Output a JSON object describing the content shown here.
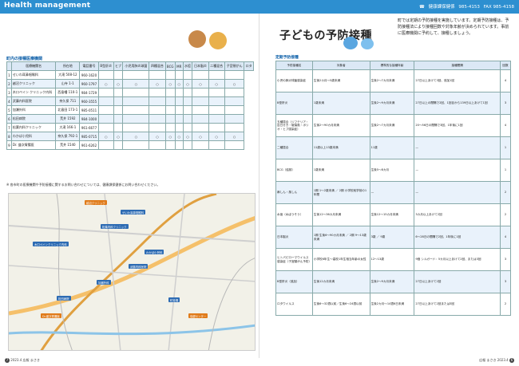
{
  "header": {
    "title": "Health management",
    "dept": "健康課保健係",
    "tel": "985-4153",
    "fax": "FAX 985-4158"
  },
  "left": {
    "section_title": "町内の接種医療機関",
    "columns": [
      "医療機関名",
      "所在地",
      "電話番号",
      "B型肝炎",
      "ヒブ",
      "小児用肺炎球菌",
      "四種混合",
      "BCG",
      "MR",
      "水痘",
      "日本脳炎",
      "二種混合",
      "子宮頸がん",
      "ロタ"
    ],
    "rows": [
      [
        "1",
        "せいわ耳鼻咽喉科",
        "大滝 508-12",
        "960-1620",
        "",
        "",
        "",
        "",
        "",
        "",
        "",
        "",
        "",
        "",
        ""
      ],
      [
        "2",
        "越沼クリニック",
        "山寺 1-1",
        "960-1797",
        "○",
        "○",
        "○",
        "○",
        "○",
        "○",
        "○",
        "○",
        "○",
        "○",
        "○"
      ],
      [
        "3",
        "木口ペイン クリニック内科",
        "西島幡 110-1",
        "984-1729",
        "",
        "",
        "",
        "",
        "",
        "",
        "",
        "",
        "",
        "",
        ""
      ],
      [
        "4",
        "武藤内科医院",
        "奈久保 711",
        "960-3555",
        "",
        "",
        "",
        "",
        "",
        "",
        "",
        "",
        "",
        "",
        ""
      ],
      [
        "5",
        "加瀬外科",
        "北島田 173-1",
        "985-0511",
        "",
        "",
        "",
        "",
        "",
        "",
        "",
        "",
        "",
        "",
        ""
      ],
      [
        "6",
        "松田病院",
        "荒井 1592",
        "984-1000",
        "",
        "",
        "",
        "",
        "",
        "",
        "",
        "",
        "",
        "",
        ""
      ],
      [
        "7",
        "松葉内科クリニック",
        "大滝 166-1",
        "961-6677",
        "",
        "",
        "",
        "",
        "",
        "",
        "",
        "",
        "",
        "",
        ""
      ],
      [
        "8",
        "わかば小児科",
        "奈久保 792-1",
        "985-0715",
        "○",
        "○",
        "○",
        "○",
        "○",
        "○",
        "○",
        "○",
        "○",
        "○",
        "○"
      ],
      [
        "9",
        "Dr. 盛次胃腸医",
        "荒井 1540",
        "961-6262",
        "",
        "",
        "",
        "",
        "",
        "",
        "",
        "",
        "",
        "",
        ""
      ]
    ],
    "note": "※ 各市町の医療機関や予防接種に関するお問い合わせについては、健康課保健係にお問い合わせください。"
  },
  "map": {
    "labels": [
      "越沼クリニック",
      "せいわ耳鼻咽喉科",
      "松葉内科クリニック",
      "木口ペインクリニック内科",
      "わかば小児科",
      "武藤内科医院",
      "加瀬外科",
      "松田病院",
      "Dr.盛次胃腸医",
      "町役場",
      "保健センター"
    ]
  },
  "right": {
    "title": "子どもの予防接種",
    "intro": "町では定期の予防接種を実施しています。定期予防接種は、予防接種法により接種回数や対象年齢が決められています。事前に医療機関に予約して、接種しましょう。",
    "section_title": "定期予防接種",
    "columns": [
      "予防接種名",
      "対象者",
      "標準的な接種年齢",
      "接種間隔",
      "回数"
    ],
    "rows": [
      [
        "小児の肺炎球菌感染症",
        "生後2カ月～5歳未満",
        "生後2～7カ月未満",
        "27日以上あけて3回、追加1回",
        "4"
      ],
      [
        "B型肝炎",
        "1歳未満",
        "生後2～9カ月未満",
        "27日以上の間隔で2回、1回目から139日以上あけて1回",
        "3"
      ],
      [
        "五種混合（ジフテリア・百日せき・破傷風・ポリオ・ヒブ感染症）",
        "生後2～90カ月未満",
        "生後2～7カ月未満",
        "20～56日の間隔で3回、1年後に1回",
        "4"
      ],
      [
        "二種混合",
        "11歳以上13歳未満",
        "11歳",
        "—",
        "1"
      ],
      [
        "BCG（結核）",
        "1歳未満",
        "生後5～8カ月",
        "—",
        "1"
      ],
      [
        "麻しん・風しん",
        "1期 1～2歳未満 ／ 2期 小学校就学前の1年間",
        "—",
        "—",
        "2"
      ],
      [
        "水痘（水ぼうそう）",
        "生後12～36カ月未満",
        "生後12～15カ月未満",
        "3カ月以上あけて2回",
        "2"
      ],
      [
        "日本脳炎",
        "1期 生後6～90カ月未満 ／ 2期 9～13歳未満",
        "3歳 ／ 9歳",
        "6～28日の間隔で2回、1年後に1回",
        "4"
      ],
      [
        "ヒトパピローマウイルス感染症（子宮頸がん予防）",
        "小学校6年生～高校1年生相当年齢の女性",
        "12～13歳",
        "9価 シルガード：5カ月以上あけて2回、または3回",
        "3"
      ],
      [
        "B型肝炎（追加）",
        "生後12カ月未満",
        "生後2～9カ月未満",
        "27日以上あけて2回",
        "3"
      ],
      [
        "ロタウイルス",
        "生後6～32週以前／生後6～24週以前",
        "生後2カ月～14週6日未満",
        "27日以上あけて2回または3回",
        "2"
      ]
    ]
  },
  "footer": {
    "left_page": "7",
    "left_text": "2023.4 広報 まさき",
    "right_page": "6",
    "right_text": "広報 まさき 2023.4"
  },
  "colors": {
    "header_blue": "#2d8fd0",
    "table_head": "#dbe8f5",
    "table_alt": "#e9f2fb",
    "label_blue": "#2d6bb3",
    "label_orange": "#e07b1a"
  }
}
